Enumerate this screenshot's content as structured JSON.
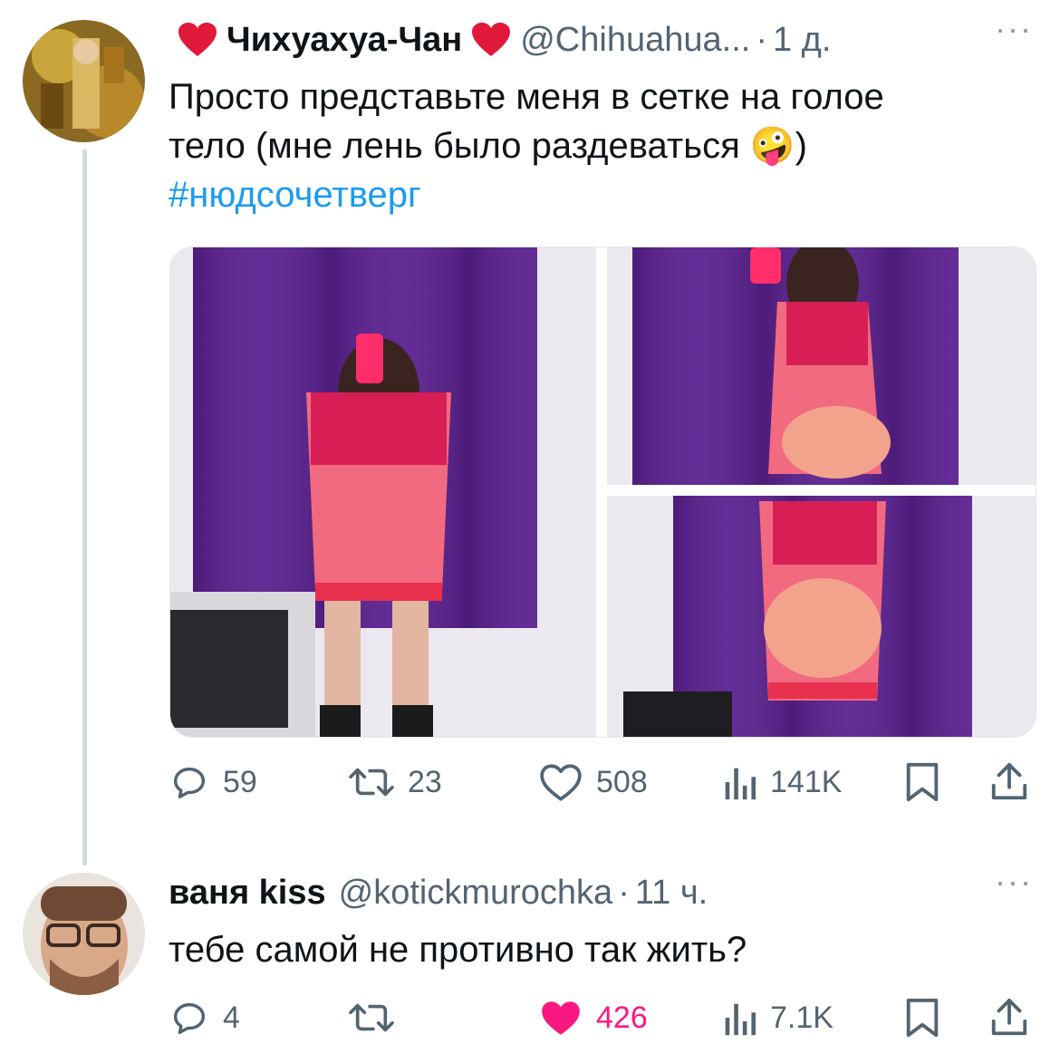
{
  "tweet": {
    "name": "Чихуахуа-Чан",
    "handle": "@Chihuahua...",
    "dot": "·",
    "time": "1 д.",
    "more": "···",
    "text_line1": "Просто представьте меня в сетке на голое",
    "text_line2": "тело (мне лень было раздеваться",
    "text_emoji": "🤪",
    "text_close": ")",
    "hashtag": "#нюдсочетверг",
    "stats": {
      "replies": "59",
      "retweets": "23",
      "likes": "508",
      "views": "141K"
    }
  },
  "reply": {
    "name": "ваня kiss",
    "handle": "@kotickmurochka",
    "dot": "·",
    "time": "11 ч.",
    "more": "···",
    "text": "тебе самой не противно так жить?",
    "stats": {
      "replies": "4",
      "retweets": "",
      "likes": "426",
      "views": "7.1K"
    }
  },
  "colors": {
    "accent": "#1d9bf0",
    "like": "#f91880",
    "secondary": "#536471",
    "heart": "#e0193a"
  },
  "icons": [
    "heart-emoji-icon",
    "reply-icon",
    "retweet-icon",
    "like-icon",
    "views-icon",
    "bookmark-icon",
    "share-icon",
    "more-icon"
  ]
}
